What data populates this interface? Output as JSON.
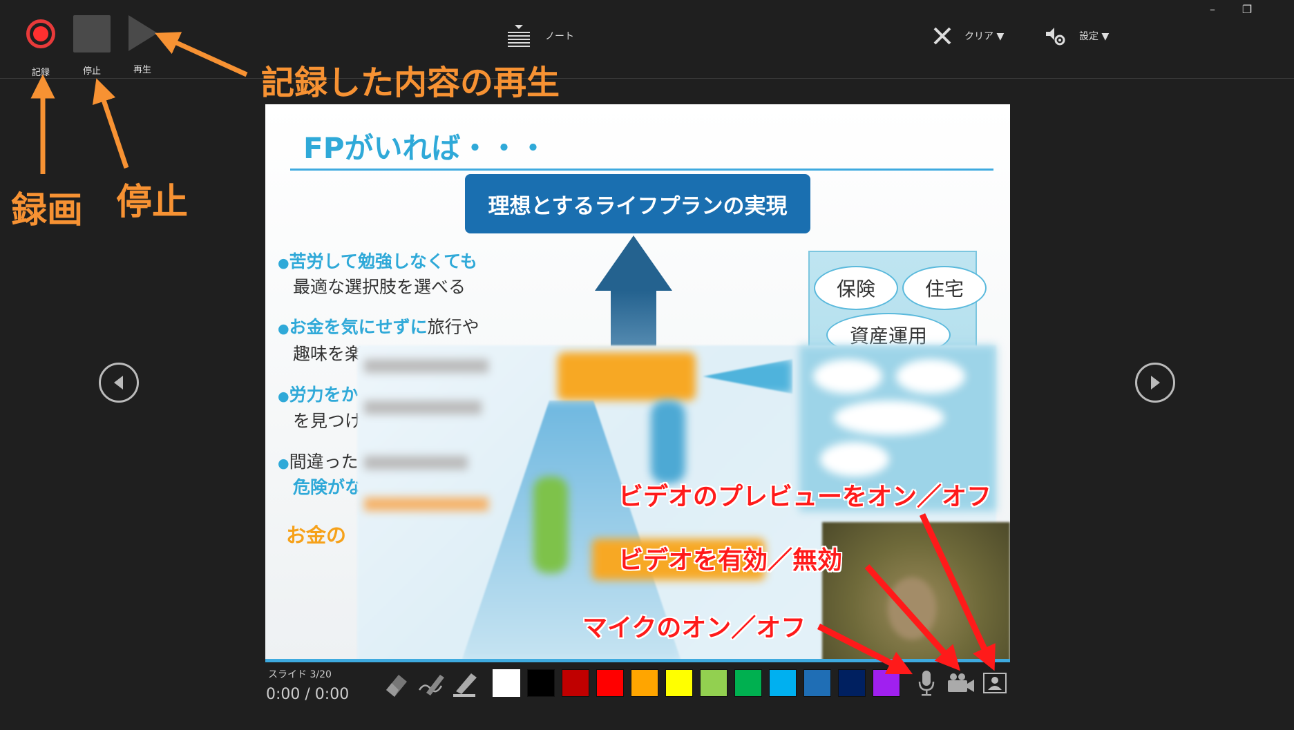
{
  "window": {
    "minimize_glyph": "–",
    "restore_glyph": "❐"
  },
  "toolbar": {
    "record_label": "記録",
    "stop_label": "停止",
    "play_label": "再生",
    "notes_label": "ノート",
    "clear_label": "クリア ▼",
    "settings_label": "設定 ▼"
  },
  "annotations": {
    "playback_note": "記録した内容の再生",
    "record_note": "録画",
    "stop_note": "停止",
    "video_preview_note": "ビデオのプレビューをオン／オフ",
    "video_toggle_note": "ビデオを有効／無効",
    "mic_note": "マイクのオン／オフ"
  },
  "slide": {
    "title": "FPがいれば・・・",
    "box_text": "理想とするライフプランの実現",
    "bullets": [
      {
        "lead": "苦労して勉強しなくても",
        "rest": "最適な選択肢を選べる"
      },
      {
        "lead": "お金を気にせずに",
        "tail": "旅行や",
        "rest": "趣味を楽"
      },
      {
        "lead": "労力をか",
        "rest": "を見つけ"
      },
      {
        "plain": "間違った",
        "rest_em": "危険がな"
      }
    ],
    "dot": "●",
    "orange_text": "お金の",
    "ovals": [
      "保険",
      "住宅",
      "資産運用"
    ]
  },
  "bottom": {
    "slide_counter": "スライド 3/20",
    "timer": "0:00 / 0:00"
  },
  "colors": {
    "swatches": [
      "#ffffff",
      "#000000",
      "#c00000",
      "#ff0000",
      "#ffa500",
      "#ffff00",
      "#92d050",
      "#00b050",
      "#00b0f0",
      "#1f6eb5",
      "#002060",
      "#a020f0"
    ],
    "annotation_orange": "#f79233",
    "annotation_red": "#ff1a1a"
  }
}
